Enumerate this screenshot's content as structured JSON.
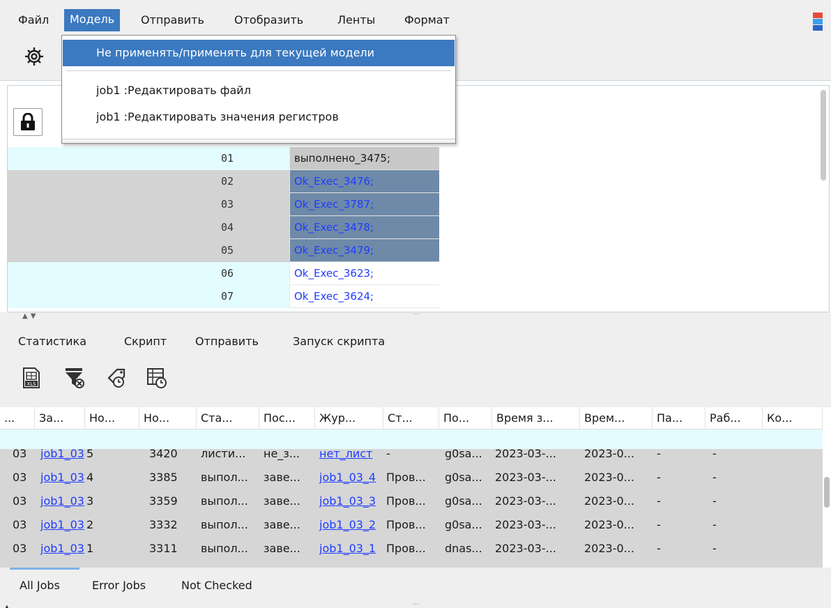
{
  "menubar": {
    "items": [
      "Файл",
      "Модель",
      "Отправить",
      "Отобразить",
      "Ленты",
      "Формат"
    ],
    "active_index": 1
  },
  "model_menu": {
    "items": [
      "Не применять/применять для текущей модели",
      "job1 :Редактировать файл",
      "job1 :Редактировать значения регистров"
    ]
  },
  "upper_grid": {
    "rows": [
      {
        "num": "01",
        "value": "выполнено_3475;"
      },
      {
        "num": "02",
        "value": "Ok_Exec_3476;"
      },
      {
        "num": "03",
        "value": "Ok_Exec_3787;"
      },
      {
        "num": "04",
        "value": "Ok_Exec_3478;"
      },
      {
        "num": "05",
        "value": "Ok_Exec_3479;"
      },
      {
        "num": "06",
        "value": "Ok_Exec_3623;"
      },
      {
        "num": "07",
        "value": "Ok_Exec_3624;"
      }
    ]
  },
  "lower_tabs": [
    "Статистика",
    "Скрипт",
    "Отправить",
    "Запуск скрипта"
  ],
  "tools": [
    "xls-export-icon",
    "filter-clear-icon",
    "tag-clock-icon",
    "table-clock-icon"
  ],
  "jobs_table": {
    "headers": [
      "...",
      "За...",
      "Но...",
      "Но...",
      "Ста...",
      "Пос...",
      "Жур...",
      "Ст...",
      "По...",
      "Время з...",
      "Врем...",
      "Па...",
      "Раб...",
      "Ко..."
    ],
    "rows": [
      [
        "03",
        "job1_03",
        "5",
        "3420",
        "листи...",
        "не_з...",
        "нет_лист",
        "-",
        "g0sa...",
        "2023-03-...",
        "2023-0...",
        "-",
        "-"
      ],
      [
        "03",
        "job1_03",
        "4",
        "3385",
        "выпол...",
        "заве...",
        "job1_03_4",
        "Пров...",
        "g0sa...",
        "2023-03-...",
        "2023-0...",
        "-",
        "-"
      ],
      [
        "03",
        "job1_03",
        "3",
        "3359",
        "выпол...",
        "заве...",
        "job1_03_3",
        "Пров...",
        "g0sa...",
        "2023-03-...",
        "2023-0...",
        "-",
        "-"
      ],
      [
        "03",
        "job1_03",
        "2",
        "3332",
        "выпол...",
        "заве...",
        "job1_03_2",
        "Пров...",
        "g0sa...",
        "2023-03-...",
        "2023-0...",
        "-",
        "-"
      ],
      [
        "03",
        "job1_03",
        "1",
        "3311",
        "выпол...",
        "заве...",
        "job1_03_1",
        "Пров...",
        "dnas...",
        "2023-03-...",
        "2023-0...",
        "-",
        "-"
      ]
    ]
  },
  "bottom_tabs": [
    "All Jobs",
    "Error Jobs",
    "Not Checked"
  ],
  "colors": {
    "accent": "#3b79c0",
    "link": "#1f3cff",
    "selection": "#6e8aa8",
    "highlight_row": "#e3fcff"
  }
}
